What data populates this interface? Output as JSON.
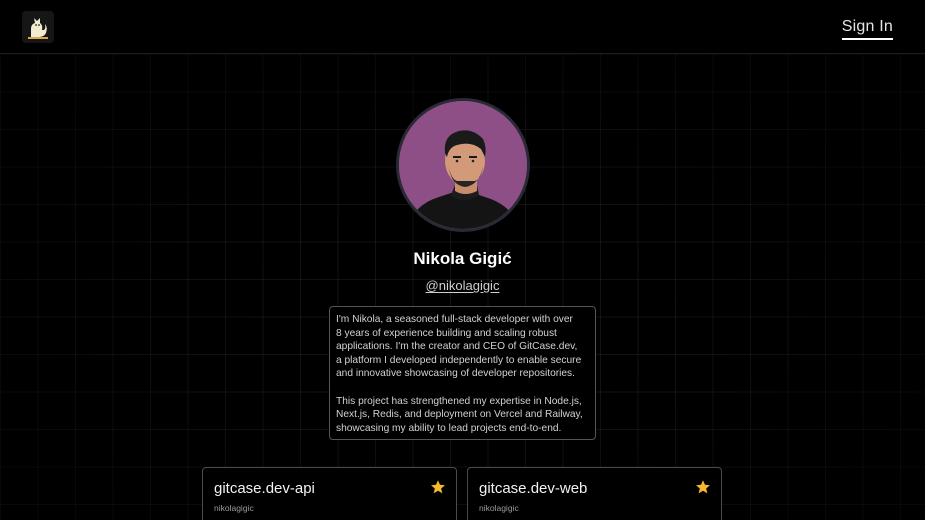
{
  "header": {
    "logo_icon": "cat-logo-icon",
    "sign_in_label": "Sign In"
  },
  "profile": {
    "avatar_icon": "profile-photo",
    "name": "Nikola Gigić",
    "handle": "@nikolagigic",
    "bio": "I'm Nikola, a seasoned full-stack developer with over\n8 years of experience building and scaling robust\napplications. I'm the creator and CEO of GitCase.dev,\na platform I developed independently to enable secure\nand innovative showcasing of developer repositories.\n\nThis project has strengthened my expertise in Node.js,\nNext.js, Redis, and deployment on Vercel and Railway,\nshowcasing my ability to lead projects end-to-end."
  },
  "repos": [
    {
      "title": "gitcase.dev-api",
      "owner": "nikolagigic",
      "starred_icon": "star-icon"
    },
    {
      "title": "gitcase.dev-web",
      "owner": "nikolagigic",
      "starred_icon": "star-icon"
    }
  ],
  "colors": {
    "background": "#000000",
    "star": "#f5b82e",
    "avatar_bg": "#8e4f86",
    "border": "#555555"
  }
}
